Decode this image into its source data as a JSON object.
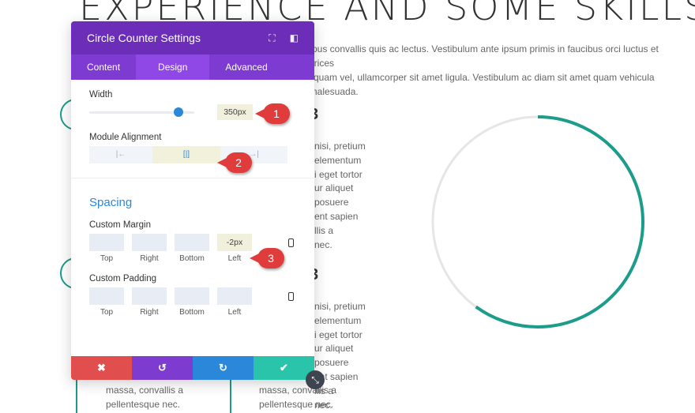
{
  "page": {
    "heading": "EXPERIENCE AND SOME SKILLS",
    "intro": [
      "mpus convallis quis ac lectus. Vestibulum ante ipsum primis in faucibus orci luctus et ultrices",
      "aliquam vel, ullamcorper sit amet ligula. Vestibulum ac diam sit amet quam vehicula",
      "t malesuada."
    ],
    "col1": [
      "nisi, pretium",
      "elementum",
      "i eget tortor",
      "ur aliquet",
      "posuere",
      "ent sapien",
      "llis a",
      "nec."
    ],
    "col2": [
      "nisi, pretium",
      "elementum",
      "i eget tortor",
      "ur aliquet",
      "posuere",
      "ent sapien",
      "llis a",
      "nec."
    ],
    "bottom_left": [
      "massa, convallis a",
      "pellentesque nec."
    ],
    "bottom_right": [
      "massa, convallis a",
      "pellentesque nec."
    ],
    "circle_counter": {
      "percent": 60,
      "bar_color": "#1c9c8a",
      "track_color": "#e6e6e6"
    }
  },
  "panel": {
    "title": "Circle Counter Settings",
    "icons": [
      "fullscreen-icon",
      "sidebar-toggle-icon"
    ],
    "tabs": [
      {
        "label": "Content"
      },
      {
        "label": "Design",
        "active": true
      },
      {
        "label": "Advanced"
      }
    ],
    "width": {
      "label": "Width",
      "value": "350px",
      "slider_fraction": 0.85
    },
    "alignment": {
      "label": "Module Alignment",
      "options": [
        "left",
        "center",
        "right"
      ],
      "selected": "center"
    },
    "spacing": {
      "title": "Spacing",
      "margin": {
        "label": "Custom Margin",
        "fields": [
          {
            "cap": "Top",
            "value": ""
          },
          {
            "cap": "Right",
            "value": ""
          },
          {
            "cap": "Bottom",
            "value": ""
          },
          {
            "cap": "Left",
            "value": "-2px"
          }
        ]
      },
      "padding": {
        "label": "Custom Padding",
        "fields": [
          {
            "cap": "Top",
            "value": ""
          },
          {
            "cap": "Right",
            "value": ""
          },
          {
            "cap": "Bottom",
            "value": ""
          },
          {
            "cap": "Left",
            "value": ""
          }
        ]
      }
    },
    "footer": {
      "cancel": "✖",
      "undo": "↺",
      "redo": "↻",
      "save": "✔",
      "colors": [
        "#e04e4e",
        "#7e3bd0",
        "#2b87da",
        "#29c4a9"
      ]
    }
  },
  "annotations": [
    "1",
    "2",
    "3"
  ]
}
